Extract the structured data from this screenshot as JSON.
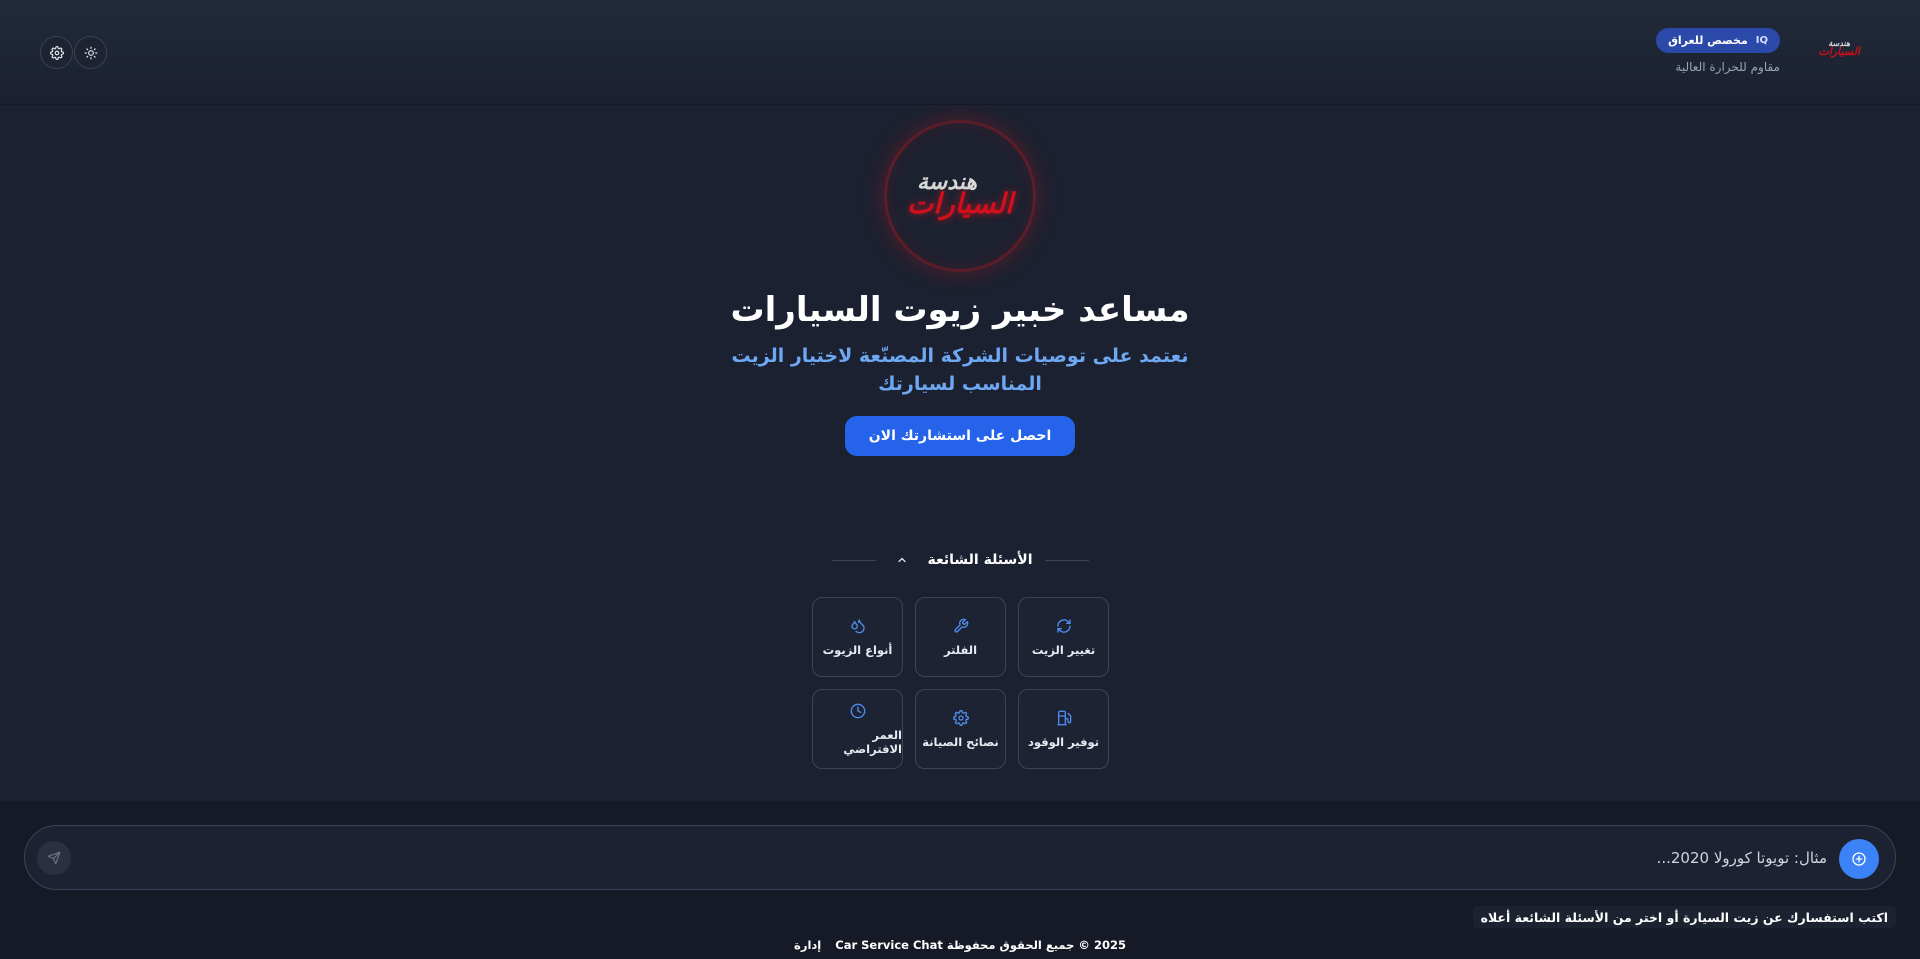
{
  "header": {
    "logo_line1": "هندسة",
    "logo_line2": "السيارات",
    "badge_country_code": "IQ",
    "badge_label": "مخصص للعراق",
    "tagline": "مقاوم للحرارة العالية",
    "settings_icon": "gear-icon",
    "theme_icon": "sun-icon"
  },
  "hero": {
    "logo_line1": "هندسة",
    "logo_line2": "السيارات",
    "title": "مساعد خبير زيوت السيارات",
    "subtitle": "نعتمد على توصيات الشركة المصنّعة لاختيار الزيت المناسب لسيارتك",
    "cta_label": "احصل على استشارتك الان"
  },
  "faq": {
    "title": "الأسئلة الشائعة",
    "items": [
      {
        "label": "تغيير الزيت",
        "icon": "refresh-icon"
      },
      {
        "label": "الفلتر",
        "icon": "wrench-icon"
      },
      {
        "label": "أنواع الزيوت",
        "icon": "droplets-icon"
      },
      {
        "label": "توفير الوقود",
        "icon": "fuel-icon"
      },
      {
        "label": "نصائح الصيانة",
        "icon": "gear-icon"
      },
      {
        "label": "العمر الافتراضي",
        "icon": "clock-icon"
      }
    ]
  },
  "chat": {
    "placeholder": "مثال: تويوتا كورولا 2020...",
    "hint": "اكتب استفسارك عن زيت السيارة أو اختر من الأسئلة الشائعة أعلاه"
  },
  "footer": {
    "copyright": "2025 © جميع الحقوق محفوظة Car Service Chat",
    "admin_link": "إدارة"
  },
  "colors": {
    "background": "#1b2130",
    "accent": "#2563eb",
    "subtitle": "#6ea7f2",
    "brand_red": "#d0101c"
  }
}
